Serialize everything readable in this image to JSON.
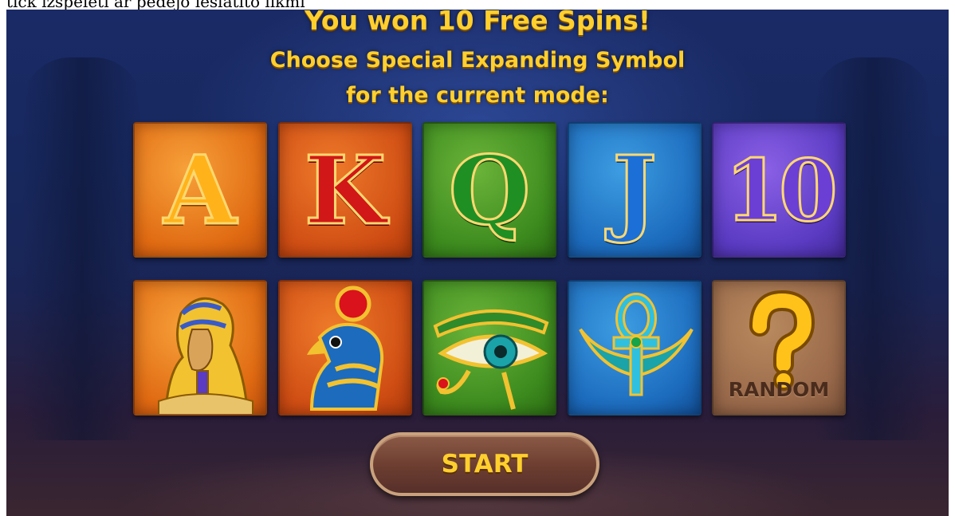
{
  "caption": "tick izspeleti ar pedejo ieslatito likmi",
  "header": {
    "line1": "You won 10 Free Spins!",
    "line2": "Choose Special Expanding Symbol",
    "line3": "for the current mode:"
  },
  "symbols_row1": [
    {
      "letter": "A",
      "icon": "letter-a-symbol",
      "color": "#e06a12"
    },
    {
      "letter": "K",
      "icon": "letter-k-symbol",
      "color": "#d04e14"
    },
    {
      "letter": "Q",
      "icon": "letter-q-symbol",
      "color": "#3c8a1e"
    },
    {
      "letter": "J",
      "icon": "letter-j-symbol",
      "color": "#1c6bbd"
    },
    {
      "letter": "10",
      "icon": "number-10-symbol",
      "color": "#5a3bc2"
    }
  ],
  "symbols_row2": [
    {
      "icon": "pharaoh-icon",
      "color": "#e06a12"
    },
    {
      "icon": "horus-falcon-icon",
      "color": "#d04e14"
    },
    {
      "icon": "eye-of-ra-icon",
      "color": "#3c8a1e"
    },
    {
      "icon": "winged-ankh-icon",
      "color": "#1c6bbd"
    },
    {
      "icon": "question-mark-icon",
      "color": "#98684a",
      "label": "RANDOM"
    }
  ],
  "start_button": {
    "label": "START"
  },
  "colors": {
    "title": "#ffcf2e",
    "background": "#17285e"
  }
}
